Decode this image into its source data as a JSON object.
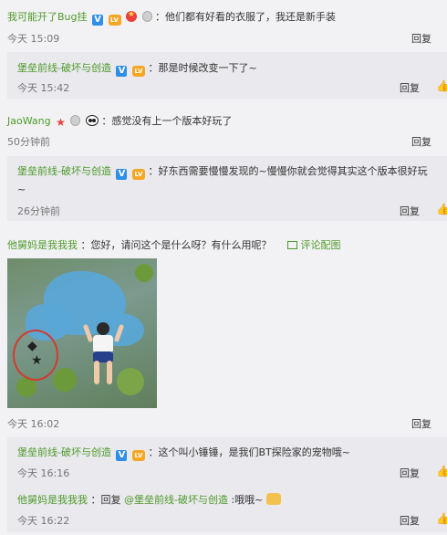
{
  "comments": [
    {
      "user": "我可能开了Bug挂",
      "text": "：他们都有好看的衣服了，我还是新手装",
      "time": "今天 15:09",
      "reply": "回复",
      "replies": [
        {
          "user": "堡垒前线-破坏与创造",
          "text": "：那是时候改变一下了~",
          "time": "今天 15:42",
          "reply": "回复"
        }
      ]
    },
    {
      "user": "JaoWang",
      "text": "：感觉没有上一个版本好玩了",
      "time": "50分钟前",
      "reply": "回复",
      "replies": [
        {
          "user": "堡垒前线-破坏与创造",
          "text": "：好东西需要慢慢发现的~慢慢你就会觉得其实这个版本很好玩",
          "text2": "~",
          "time": "26分钟前",
          "reply": "回复"
        }
      ]
    },
    {
      "user": "他舅妈是我我我",
      "text": "：您好，请问这个是什么呀？有什么用呢？",
      "image_link": "评论配图",
      "time": "今天 16:02",
      "reply": "回复",
      "replies": [
        {
          "user": "堡垒前线-破坏与创造",
          "text": "：这个叫小锤锤，是我们BT探险家的宠物哦~",
          "time": "今天 16:16",
          "reply": "回复"
        },
        {
          "user": "他舅妈是我我我",
          "text_prefix": "：回复",
          "mention": "@堡垒前线-破坏与创造",
          "text_suffix": ":哦哦~",
          "time": "今天 16:22",
          "reply": "回复"
        }
      ]
    }
  ],
  "icons": {
    "verified": "V",
    "level": "LV",
    "like": "thumbs-up-icon",
    "image": "image-icon"
  },
  "colors": {
    "username": "#4f9a2a",
    "verified": "#2f8fe8",
    "background": "#f2f2f5",
    "reply_background": "#e9e9ee"
  }
}
